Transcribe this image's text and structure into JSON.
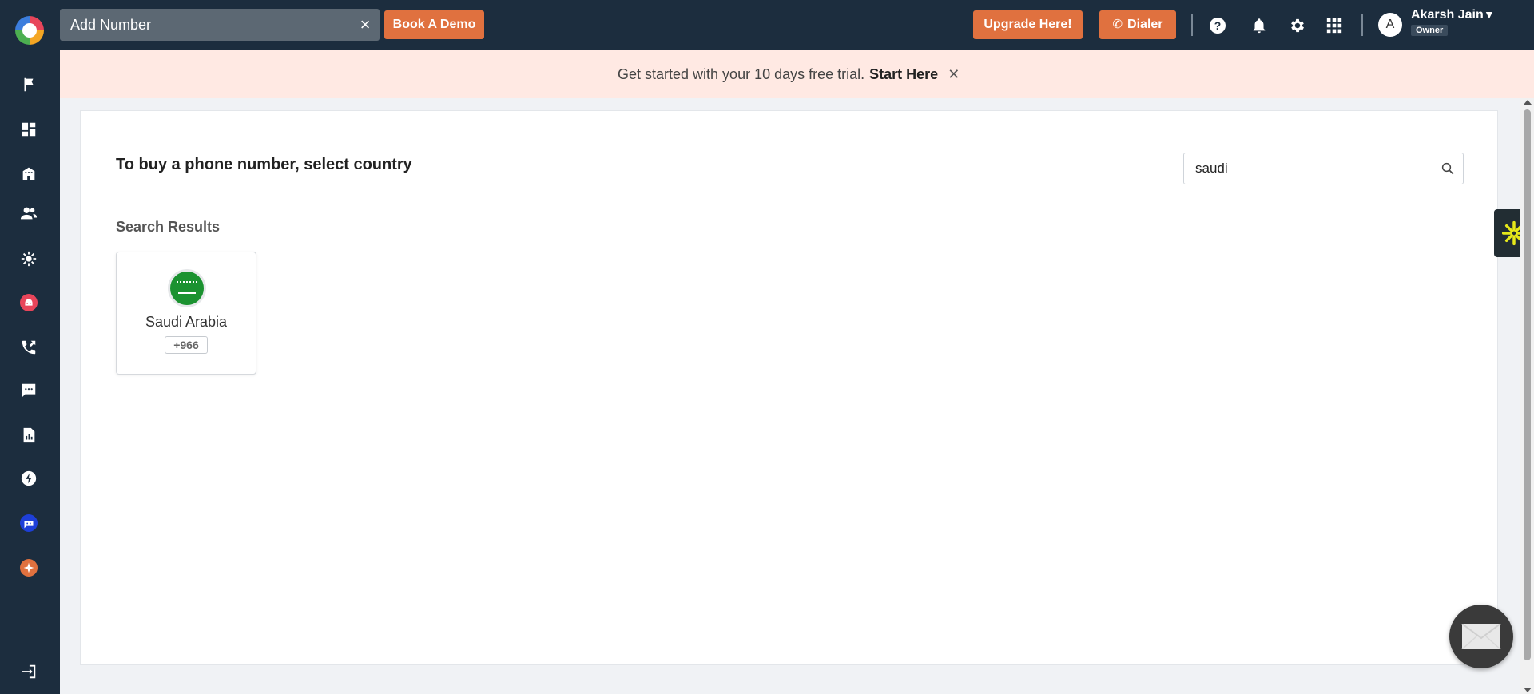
{
  "topbar": {
    "search_placeholder": "Add Number",
    "book_demo_label": "Book A Demo",
    "upgrade_label": "Upgrade Here!",
    "dialer_label": "Dialer",
    "user": {
      "avatar_letter": "A",
      "name": "Akarsh Jain",
      "role": "Owner"
    },
    "icons": [
      "help-icon",
      "bell-icon",
      "gear-icon",
      "apps-grid-icon"
    ]
  },
  "sidebar": {
    "items": [
      "flag-icon",
      "dashboard-icon",
      "building-icon",
      "contacts-icon",
      "integrations-icon",
      "bot-icon",
      "call-transfer-icon",
      "chat-icon",
      "reports-icon",
      "power-dialer-icon",
      "ai-assistant-icon",
      "sparkle-icon",
      "logout-icon"
    ]
  },
  "banner": {
    "text": "Get started with your 10 days free trial.",
    "link": "Start Here",
    "close": "✕"
  },
  "main": {
    "title": "To buy a phone number, select country",
    "search_value": "saudi",
    "results_title": "Search Results",
    "results": [
      {
        "name": "Saudi Arabia",
        "code": "+966",
        "flag_color": "#1b9230"
      }
    ]
  },
  "colors": {
    "topbar_bg": "#1c2d3e",
    "accent_orange": "#e0713f",
    "banner_bg": "#ffe9e3"
  }
}
